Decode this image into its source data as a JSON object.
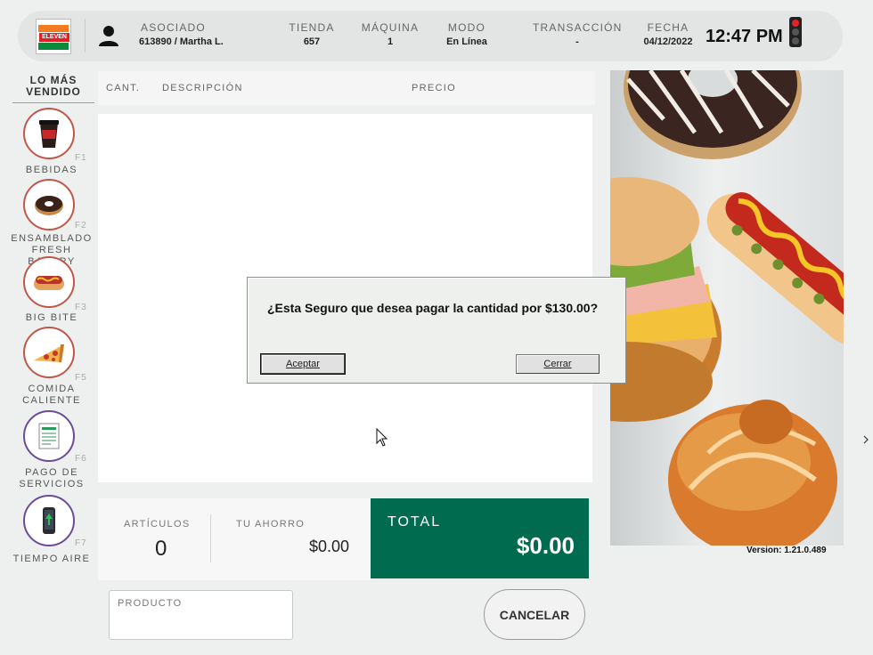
{
  "header": {
    "asociado": {
      "label": "ASOCIADO",
      "value": "613890  /  Martha L."
    },
    "tienda": {
      "label": "TIENDA",
      "value": "657"
    },
    "maquina": {
      "label": "MÁQUINA",
      "value": "1"
    },
    "modo": {
      "label": "MODO",
      "value": "En Línea"
    },
    "transaccion": {
      "label": "TRANSACCIÓN",
      "value": "-"
    },
    "fecha": {
      "label": "FECHA",
      "value": "04/12/2022"
    },
    "clock": "12:47 PM",
    "logo_text": "ELEVEN"
  },
  "sidebar": {
    "title": "LO MÁS VENDIDO",
    "items": [
      {
        "label": "BEBIDAS",
        "key": "F1",
        "icon": "drink-cup-icon"
      },
      {
        "label": "ENSAMBLADO FRESH BAKERY",
        "key": "F2",
        "icon": "donut-icon"
      },
      {
        "label": "BIG BITE",
        "key": "F3",
        "icon": "hotdog-icon"
      },
      {
        "label": "COMIDA CALIENTE",
        "key": "F5",
        "icon": "pizza-slice-icon"
      },
      {
        "label": "PAGO DE SERVICIOS",
        "key": "F6",
        "icon": "bill-receipt-icon"
      },
      {
        "label": "TIEMPO AIRE",
        "key": "F7",
        "icon": "phone-topup-icon"
      }
    ]
  },
  "list": {
    "col_qty": "CANT.",
    "col_desc": "DESCRIPCIÓN",
    "col_price": "PRECIO"
  },
  "totals": {
    "articles_label": "ARTÍCULOS",
    "articles_value": "0",
    "savings_label": "TU AHORRO",
    "savings_value": "$0.00",
    "total_label": "TOTAL",
    "total_value": "$0.00"
  },
  "product_input": {
    "label": "PRODUCTO"
  },
  "cancel_label": "CANCELAR",
  "version": "Version: 1.21.0.489",
  "dialog": {
    "message": "¿Esta Seguro que desea pagar la cantidad por $130.00?",
    "accept_label": "Aceptar",
    "close_label": "Cerrar"
  },
  "colors": {
    "total_bg": "#006b4f",
    "brand_orange": "#f47b20",
    "brand_red": "#e01f26",
    "brand_green": "#0b8a3e"
  }
}
